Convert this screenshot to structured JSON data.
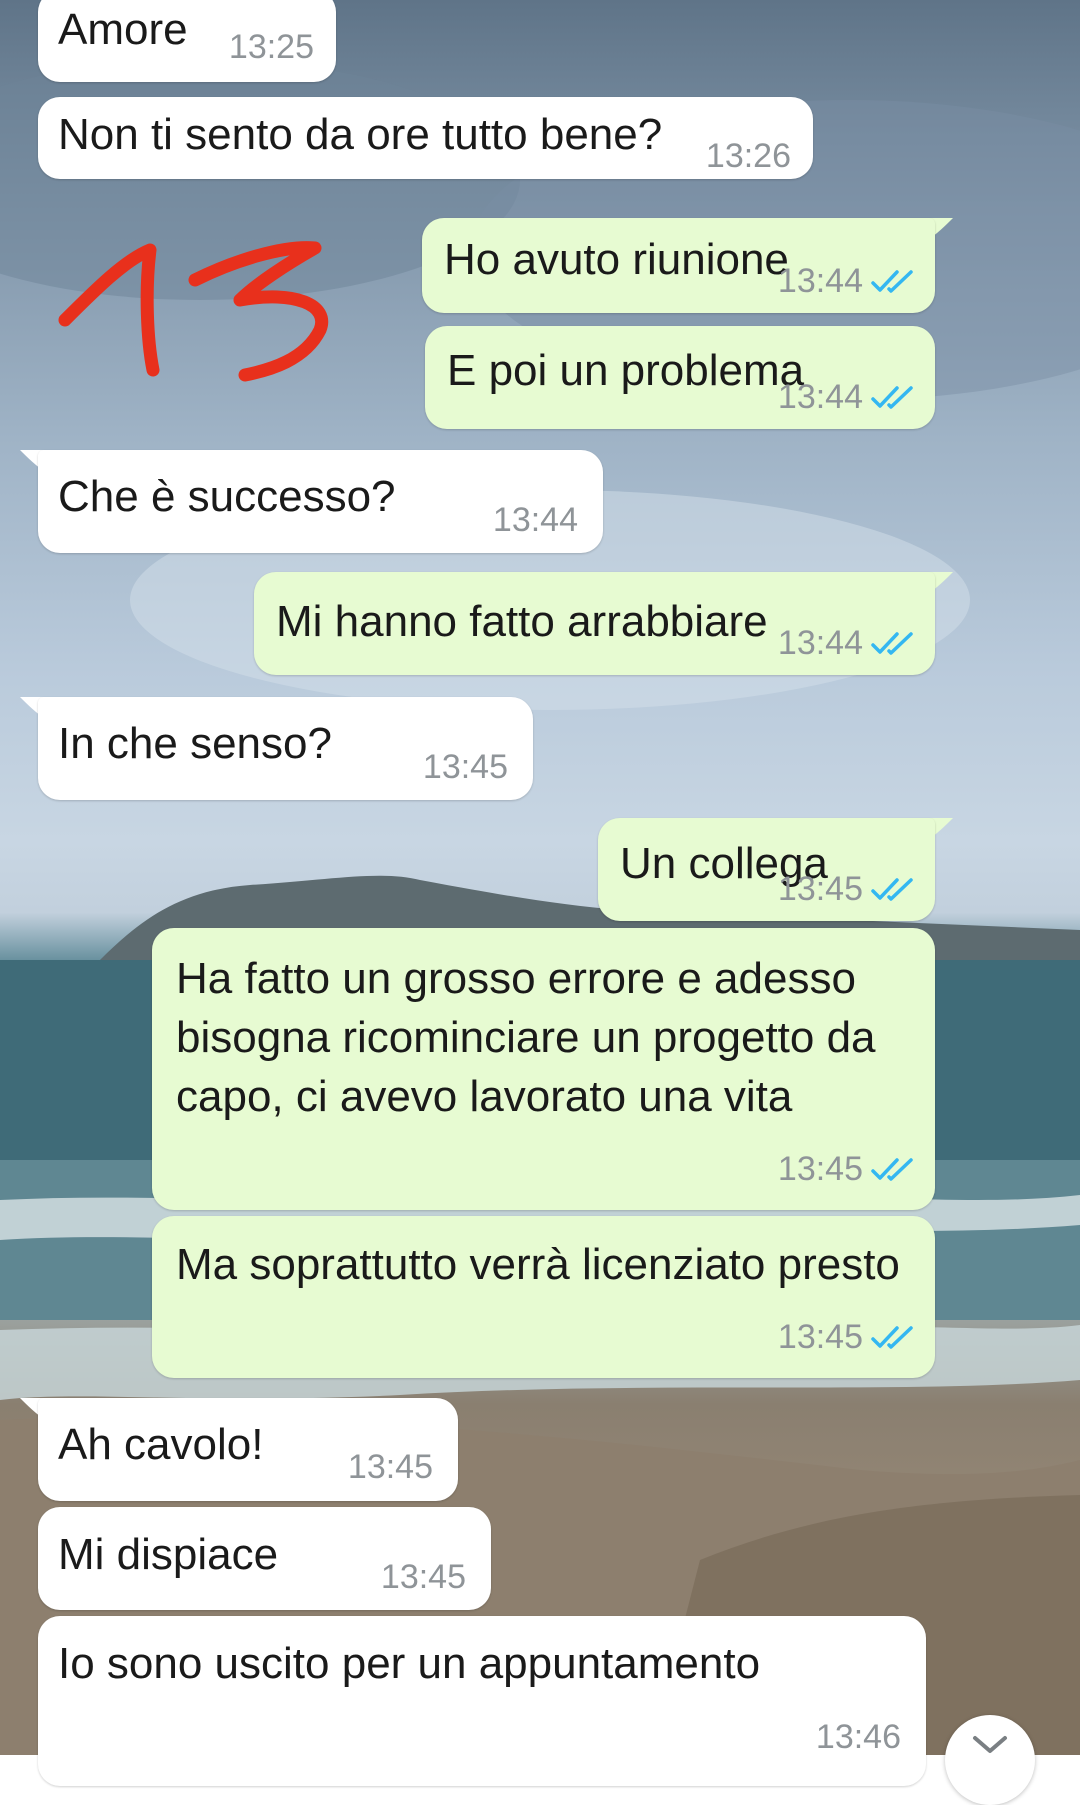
{
  "chat": {
    "messages": [
      {
        "direction": "in",
        "text": "Amore",
        "time": "13:25"
      },
      {
        "direction": "in",
        "text": "Non ti sento da ore tutto bene?",
        "time": "13:26"
      },
      {
        "direction": "out",
        "text": "Ho avuto riunione",
        "time": "13:44",
        "status": "read"
      },
      {
        "direction": "out",
        "text": "E poi un problema",
        "time": "13:44",
        "status": "read"
      },
      {
        "direction": "in",
        "text": "Che è successo?",
        "time": "13:44"
      },
      {
        "direction": "out",
        "text": "Mi hanno fatto arrabbiare",
        "time": "13:44",
        "status": "read"
      },
      {
        "direction": "in",
        "text": "In che senso?",
        "time": "13:45"
      },
      {
        "direction": "out",
        "text": "Un collega",
        "time": "13:45",
        "status": "read"
      },
      {
        "direction": "out",
        "text": "Ha fatto un grosso errore e adesso bisogna ricominciare un progetto da capo, ci avevo lavorato una vita",
        "time": "13:45",
        "status": "read"
      },
      {
        "direction": "out",
        "text": "Ma soprattutto verrà licenziato presto",
        "time": "13:45",
        "status": "read"
      },
      {
        "direction": "in",
        "text": "Ah cavolo!",
        "time": "13:45"
      },
      {
        "direction": "in",
        "text": "Mi dispiace",
        "time": "13:45"
      },
      {
        "direction": "in",
        "text": "Io sono uscito per un appuntamento",
        "time": "13:46"
      }
    ]
  },
  "annotation": {
    "text": "13",
    "color": "#e8301c"
  },
  "colors": {
    "incoming_bubble": "#ffffff",
    "outgoing_bubble": "#e7fbd2",
    "read_tick": "#34b7f1",
    "time_text": "#8f9498"
  },
  "icons": {
    "read_receipt": "double-check-icon",
    "scroll_down": "chevron-down-icon"
  }
}
